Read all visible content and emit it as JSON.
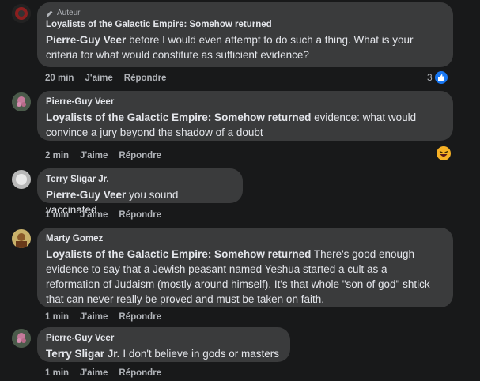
{
  "comments": [
    {
      "badge": "Auteur",
      "mention": "Loyalists of the Galactic Empire: Somehow returned",
      "reply_to": "Pierre-Guy Veer",
      "body": " before I would even attempt to do such a thing. What is your criteria for what would constitute as sufficient evidence?",
      "time": "20 min",
      "like": "J'aime",
      "reply": "Répondre",
      "reaction_count": "3"
    },
    {
      "author": "Pierre-Guy Veer",
      "reply_to": "Loyalists of the Galactic Empire: Somehow returned",
      "body": " evidence: what would convince a jury beyond the shadow of a doubt",
      "time": "2 min",
      "like": "J'aime",
      "reply": "Répondre"
    },
    {
      "author": "Terry Sligar Jr.",
      "reply_to": "Pierre-Guy Veer",
      "body": " you sound vaccinated.",
      "time": "1 min",
      "like": "J'aime",
      "reply": "Répondre"
    },
    {
      "author": "Marty Gomez",
      "reply_to": "Loyalists of the Galactic Empire: Somehow returned",
      "body": " There's good enough evidence to say that a Jewish peasant named Yeshua started a cult as a reformation of Judaism (mostly around himself). It's that whole \"son of god\" shtick that can never really be proved and must be taken on faith.",
      "time": "1 min",
      "like": "J'aime",
      "reply": "Répondre"
    },
    {
      "author": "Pierre-Guy Veer",
      "reply_to": "Terry Sligar Jr.",
      "body": " I don't believe in gods or masters",
      "time": "1 min",
      "like": "J'aime",
      "reply": "Répondre"
    }
  ],
  "colors": {
    "background": "#18191a",
    "bubble": "#3a3b3c",
    "like_blue": "#1877f2",
    "haha_yellow": "#f7b125"
  }
}
